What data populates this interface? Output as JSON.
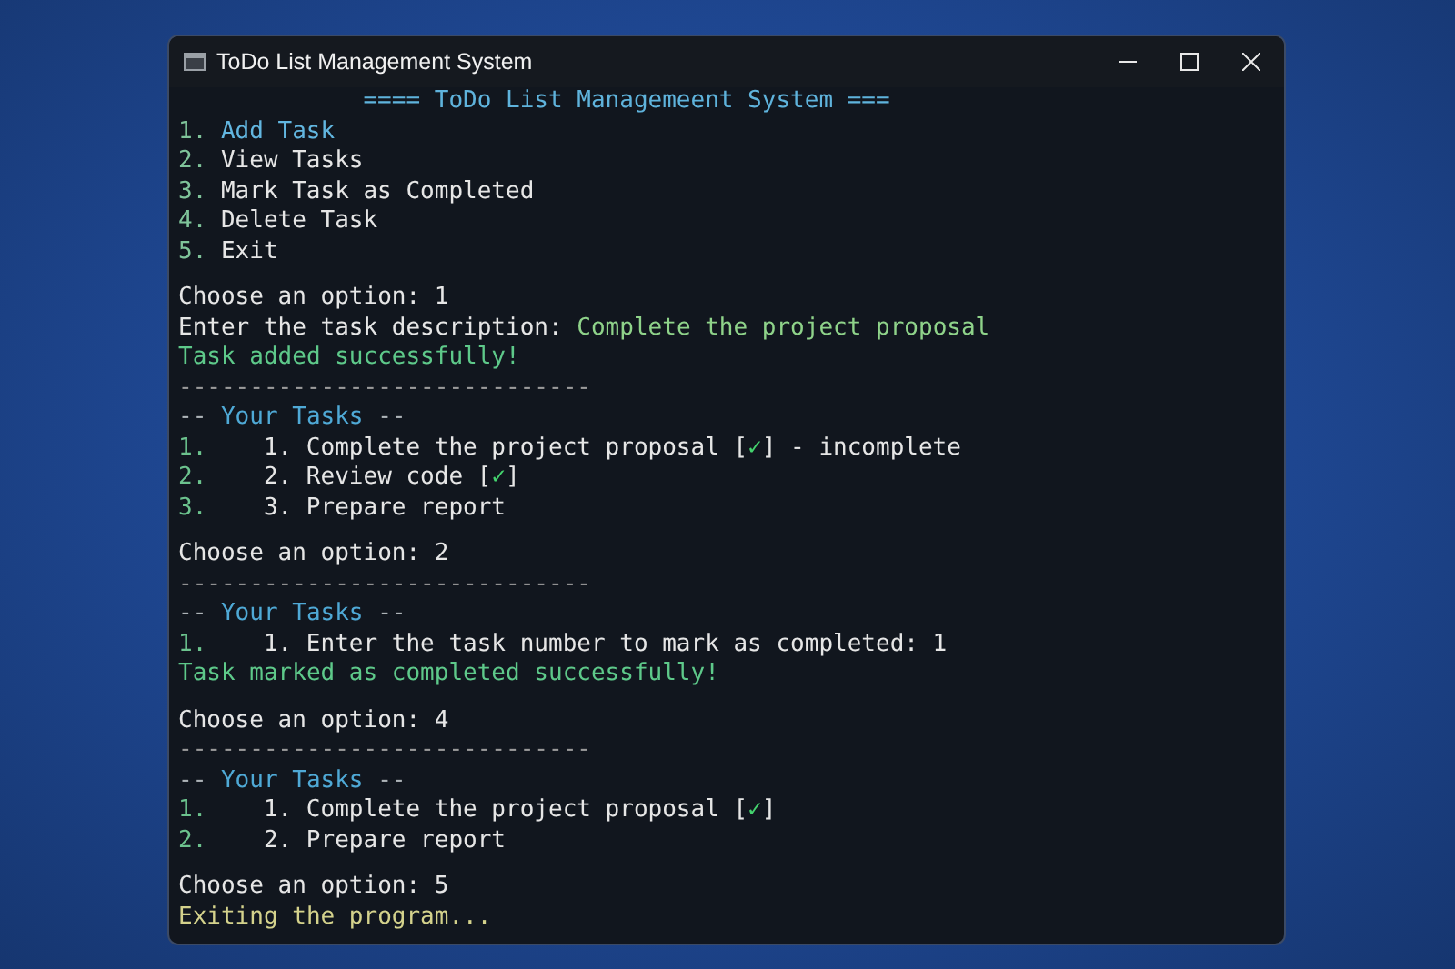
{
  "window": {
    "title": "ToDo List Management System"
  },
  "blocks": [
    {
      "lines": [
        {
          "segments": [
            {
              "kind": "heading",
              "text": "==== ToDo List Managemeent System ==="
            }
          ]
        },
        {
          "segments": [
            {
              "kind": "number",
              "text": "1."
            },
            {
              "kind": "menu",
              "text": "Add Task",
              "selected": true
            }
          ]
        },
        {
          "segments": [
            {
              "kind": "number",
              "text": "2."
            },
            {
              "kind": "menu",
              "text": "View Tasks",
              "selected": false
            }
          ]
        },
        {
          "segments": [
            {
              "kind": "number",
              "text": "3."
            },
            {
              "kind": "menu",
              "text": "Mark Task as Completed",
              "selected": false
            }
          ]
        },
        {
          "segments": [
            {
              "kind": "number",
              "text": "4."
            },
            {
              "kind": "menu",
              "text": "Delete Task",
              "selected": false
            }
          ]
        },
        {
          "segments": [
            {
              "kind": "number",
              "text": "5."
            },
            {
              "kind": "menu",
              "text": "Exit",
              "selected": false
            }
          ]
        }
      ]
    },
    {
      "lines": [
        {
          "segments": [
            {
              "kind": "prompt",
              "text": "Choose an option: 1"
            }
          ]
        },
        {
          "segments": [
            {
              "kind": "prompt",
              "text": "Enter the task description: "
            },
            {
              "kind": "input",
              "text": "Complete the project proposal"
            }
          ]
        },
        {
          "segments": [
            {
              "kind": "success",
              "text": "Task added successfully!"
            }
          ]
        },
        {
          "segments": [
            {
              "kind": "rule",
              "text": "-----------------------------"
            }
          ]
        },
        {
          "segments": [
            {
              "kind": "dashes",
              "text": "-- "
            },
            {
              "kind": "section",
              "text": "Your Tasks"
            },
            {
              "kind": "dashes",
              "text": " --"
            }
          ]
        },
        {
          "segments": [
            {
              "kind": "index",
              "text": "1."
            },
            {
              "kind": "task",
              "text": "1. Complete the project proposal ["
            },
            {
              "kind": "check",
              "text": "✓"
            },
            {
              "kind": "task",
              "text": "] - incomplete"
            }
          ]
        },
        {
          "segments": [
            {
              "kind": "index",
              "text": "2."
            },
            {
              "kind": "task",
              "text": "2. Review code ["
            },
            {
              "kind": "check",
              "text": "✓"
            },
            {
              "kind": "task",
              "text": "]"
            }
          ]
        },
        {
          "segments": [
            {
              "kind": "index",
              "text": "3."
            },
            {
              "kind": "task",
              "text": "3. Prepare report"
            }
          ]
        }
      ]
    },
    {
      "lines": [
        {
          "segments": [
            {
              "kind": "prompt",
              "text": "Choose an option: 2"
            }
          ]
        },
        {
          "segments": [
            {
              "kind": "rule",
              "text": "-----------------------------"
            }
          ]
        },
        {
          "segments": [
            {
              "kind": "dashes",
              "text": "-- "
            },
            {
              "kind": "section",
              "text": "Your Tasks"
            },
            {
              "kind": "dashes",
              "text": " --"
            }
          ]
        },
        {
          "segments": [
            {
              "kind": "index",
              "text": "1."
            },
            {
              "kind": "task",
              "text": "1. Enter the task number to mark as completed: 1"
            }
          ]
        },
        {
          "segments": [
            {
              "kind": "success",
              "text": "Task marked as completed successfully!"
            }
          ]
        }
      ]
    },
    {
      "lines": [
        {
          "segments": [
            {
              "kind": "prompt",
              "text": "Choose an option: 4"
            }
          ]
        },
        {
          "segments": [
            {
              "kind": "rule",
              "text": "-----------------------------"
            }
          ]
        },
        {
          "segments": [
            {
              "kind": "dashes",
              "text": "-- "
            },
            {
              "kind": "section",
              "text": "Your Tasks"
            },
            {
              "kind": "dashes",
              "text": " --"
            }
          ]
        },
        {
          "segments": [
            {
              "kind": "index",
              "text": "1."
            },
            {
              "kind": "task",
              "text": "1. Complete the project proposal ["
            },
            {
              "kind": "check",
              "text": "✓"
            },
            {
              "kind": "task",
              "text": "]"
            }
          ]
        },
        {
          "segments": [
            {
              "kind": "index",
              "text": "2."
            },
            {
              "kind": "task",
              "text": "2. Prepare report"
            }
          ]
        }
      ]
    },
    {
      "lines": [
        {
          "segments": [
            {
              "kind": "prompt",
              "text": "Choose an option: 5"
            }
          ]
        },
        {
          "segments": [
            {
              "kind": "exit",
              "text": "Exiting the program..."
            }
          ]
        }
      ]
    }
  ]
}
